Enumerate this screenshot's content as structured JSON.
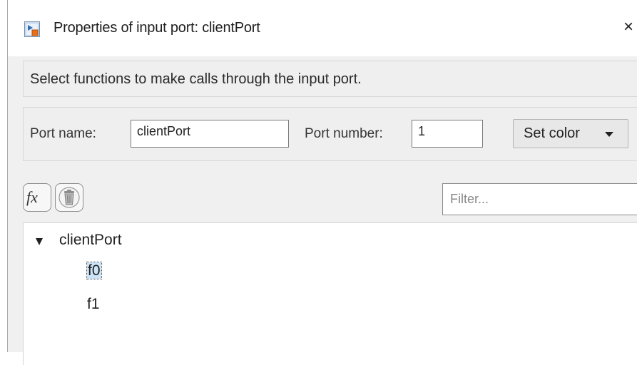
{
  "window": {
    "title": "Properties of input port: clientPort",
    "close_glyph": "×",
    "icon": "simulink-block-icon"
  },
  "description": "Select functions to make calls through the input port.",
  "port": {
    "name_label": "Port name:",
    "name_value": "clientPort",
    "number_label": "Port number:",
    "number_value": "1",
    "set_color_label": "Set color"
  },
  "toolbar": {
    "add_function_label": "fx",
    "add_function_icon": "fx-icon",
    "delete_icon": "trash-icon",
    "filter_placeholder": "Filter..."
  },
  "tree": {
    "root": {
      "label": "clientPort",
      "expanded": true
    },
    "children": [
      {
        "label": "f0",
        "selected": true
      },
      {
        "label": "f1",
        "selected": false
      }
    ]
  },
  "colors": {
    "selection": "#cce4f7",
    "panel_bg": "#efefef",
    "window_bg": "#f0f0f0"
  }
}
